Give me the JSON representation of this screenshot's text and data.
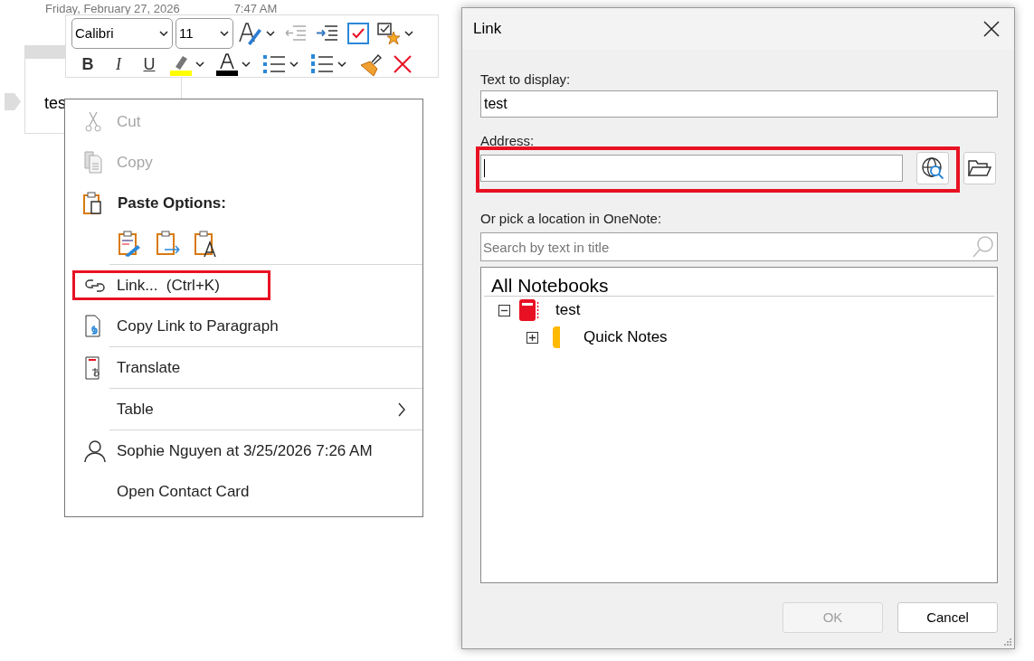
{
  "note": {
    "date": "Friday, February 27, 2026",
    "time": "7:47 AM",
    "text": "tes"
  },
  "toolbar": {
    "font": "Calibri",
    "size": "11",
    "format_buttons": [
      "B",
      "I",
      "U"
    ]
  },
  "context_menu": {
    "items": [
      {
        "kind": "item",
        "label": "Cut",
        "disabled": true,
        "highlighted": false
      },
      {
        "kind": "item",
        "label": "Copy",
        "disabled": true,
        "highlighted": false
      },
      {
        "kind": "header",
        "label": "Paste Options:"
      },
      {
        "kind": "paste"
      },
      {
        "kind": "item",
        "label": "Link...  (Ctrl+K)",
        "disabled": false,
        "highlighted": true
      },
      {
        "kind": "item",
        "label": "Copy Link to Paragraph",
        "disabled": false,
        "highlighted": false
      },
      {
        "kind": "item",
        "label": "Translate",
        "disabled": false,
        "highlighted": false
      },
      {
        "kind": "submenu",
        "label": "Table",
        "disabled": false,
        "highlighted": false
      },
      {
        "kind": "item",
        "label": "Sophie Nguyen at 3/25/2026 7:26 AM",
        "disabled": false,
        "highlighted": false
      },
      {
        "kind": "item",
        "label": "Open Contact Card",
        "disabled": false,
        "highlighted": false
      }
    ]
  },
  "dialog": {
    "title": "Link",
    "text_label": "Text to display:",
    "text_value": "test",
    "address_label": "Address:",
    "address_highlighted": true,
    "location_label": "Or pick a location in OneNote:",
    "search": {
      "placeholder": "Search by text in title"
    },
    "tree": {
      "header": "All Notebooks",
      "items": [
        {
          "label": "test",
          "kind": "notebook",
          "color": "#e81123",
          "expanded": true,
          "children": [
            {
              "label": "Quick Notes",
              "kind": "section",
              "color": "#ffb900",
              "expanded": false
            }
          ]
        }
      ]
    },
    "buttons": [
      {
        "label": "OK",
        "disabled": true
      },
      {
        "label": "Cancel",
        "disabled": false
      }
    ]
  }
}
